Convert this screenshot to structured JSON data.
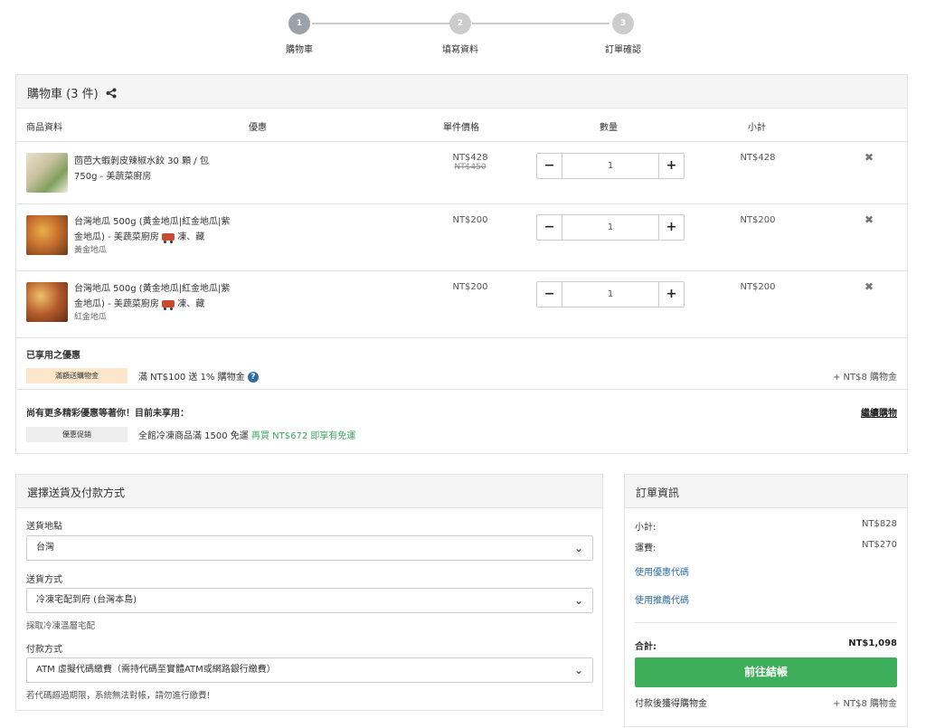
{
  "steps": [
    {
      "num": "1",
      "label": "購物車"
    },
    {
      "num": "2",
      "label": "填寫資料"
    },
    {
      "num": "3",
      "label": "訂單確認"
    }
  ],
  "cart": {
    "title": "購物車",
    "count": "(3 件)",
    "columns": {
      "product": "商品資料",
      "promo": "優惠",
      "unit_price": "單件價格",
      "quantity": "數量",
      "subtotal": "小計"
    },
    "items": [
      {
        "name": "茴芭大蝦剝皮辣椒水餃 30 顆 / 包 750g - 美蔬菜廚房",
        "variant": "",
        "price": "NT$428",
        "old_price": "NT$450",
        "qty": "1",
        "subtotal": "NT$428"
      },
      {
        "name": "台灣地瓜 500g (黃金地瓜|紅金地瓜|紫金地瓜) - 美蔬菜廚房",
        "storage": "凍、藏",
        "variant": "黃金地瓜",
        "price": "NT$200",
        "old_price": "",
        "qty": "1",
        "subtotal": "NT$200"
      },
      {
        "name": "台灣地瓜 500g (黃金地瓜|紅金地瓜|紫金地瓜) - 美蔬菜廚房",
        "storage": "凍、藏",
        "variant": "紅金地瓜",
        "price": "NT$200",
        "old_price": "",
        "qty": "1",
        "subtotal": "NT$200"
      }
    ],
    "applied": {
      "title": "已享用之優惠",
      "tag": "滿額送購物金",
      "text": "滿 NT$100 送 1% 購物金",
      "reward": "+ NT$8 購物金"
    },
    "more": {
      "title": "尚有更多精彩優惠等著你！目前未享用：",
      "continue": "繼續購物",
      "tag": "優惠促銷",
      "text": "全館冷凍商品滿 1500 免運",
      "highlight": "再買 NT$672 即享有免運"
    }
  },
  "shipping": {
    "title": "選擇送貨及付款方式",
    "location_label": "送貨地點",
    "location_value": "台灣",
    "method_label": "送貨方式",
    "method_value": "冷凍宅配到府 (台灣本島)",
    "method_note": "採取冷凍溫層宅配",
    "payment_label": "付款方式",
    "payment_value": "ATM 虛擬代碼繳費（需持代碼至實體ATM或網路銀行繳費）",
    "payment_note": "若代碼超過期限，系統無法對帳，請勿進行繳費!"
  },
  "order": {
    "title": "訂單資訊",
    "subtotal_label": "小計:",
    "subtotal_value": "NT$828",
    "shipping_label": "運費:",
    "shipping_value": "NT$270",
    "coupon_link": "使用優惠代碼",
    "referral_link": "使用推薦代碼",
    "total_label": "合計:",
    "total_value": "NT$1,098",
    "checkout": "前往結帳",
    "reward_label": "付款後獲得購物金",
    "reward_value": "+ NT$8 購物金"
  },
  "colors": {
    "accent_green": "#3fae5a",
    "link_blue": "#2d6ca2",
    "promo_tag": "#fce6cc"
  }
}
